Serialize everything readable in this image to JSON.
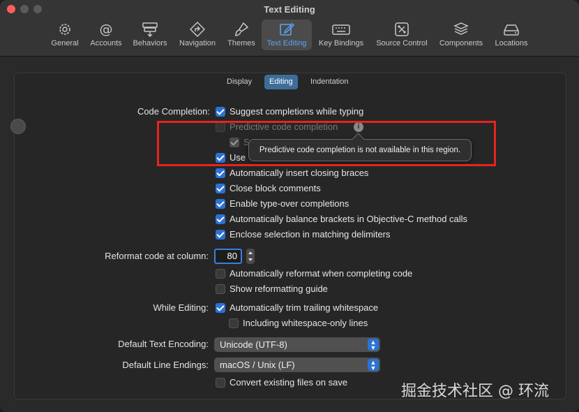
{
  "window": {
    "title": "Text Editing"
  },
  "toolbar": {
    "items": [
      {
        "label": "General",
        "icon": "gear-icon"
      },
      {
        "label": "Accounts",
        "icon": "at-icon"
      },
      {
        "label": "Behaviors",
        "icon": "behaviors-icon"
      },
      {
        "label": "Navigation",
        "icon": "navigation-icon"
      },
      {
        "label": "Themes",
        "icon": "brush-icon"
      },
      {
        "label": "Text Editing",
        "icon": "pencil-square-icon",
        "active": true
      },
      {
        "label": "Key Bindings",
        "icon": "keyboard-icon"
      },
      {
        "label": "Source Control",
        "icon": "source-control-icon"
      },
      {
        "label": "Components",
        "icon": "layers-icon"
      },
      {
        "label": "Locations",
        "icon": "drive-icon"
      }
    ]
  },
  "tabs": [
    "Display",
    "Editing",
    "Indentation"
  ],
  "active_tab": "Editing",
  "form": {
    "code_completion_label": "Code Completion:",
    "suggest": "Suggest completions while typing",
    "predictive": "Predictive code completion",
    "sub_option_partial": "S",
    "use_partial": "Use",
    "tooltip": "Predictive code completion is not available in this region.",
    "closing_braces": "Automatically insert closing braces",
    "close_block": "Close block comments",
    "type_over": "Enable type-over completions",
    "balance_brackets": "Automatically balance brackets in Objective-C method calls",
    "enclose_selection": "Enclose selection in matching delimiters",
    "reformat_label": "Reformat code at column:",
    "reformat_value": "80",
    "auto_reformat": "Automatically reformat when completing code",
    "show_guide": "Show reformatting guide",
    "while_editing_label": "While Editing:",
    "trim_whitespace": "Automatically trim trailing whitespace",
    "whitespace_only": "Including whitespace-only lines",
    "encoding_label": "Default Text Encoding:",
    "encoding_value": "Unicode (UTF-8)",
    "line_endings_label": "Default Line Endings:",
    "line_endings_value": "macOS / Unix (LF)",
    "convert_files": "Convert existing files on save"
  },
  "watermark": "掘金技术社区 @ 环流",
  "colors": {
    "accent": "#2b72d6",
    "highlight_box": "#e8231e",
    "active_tab": "#3e6d9a"
  }
}
